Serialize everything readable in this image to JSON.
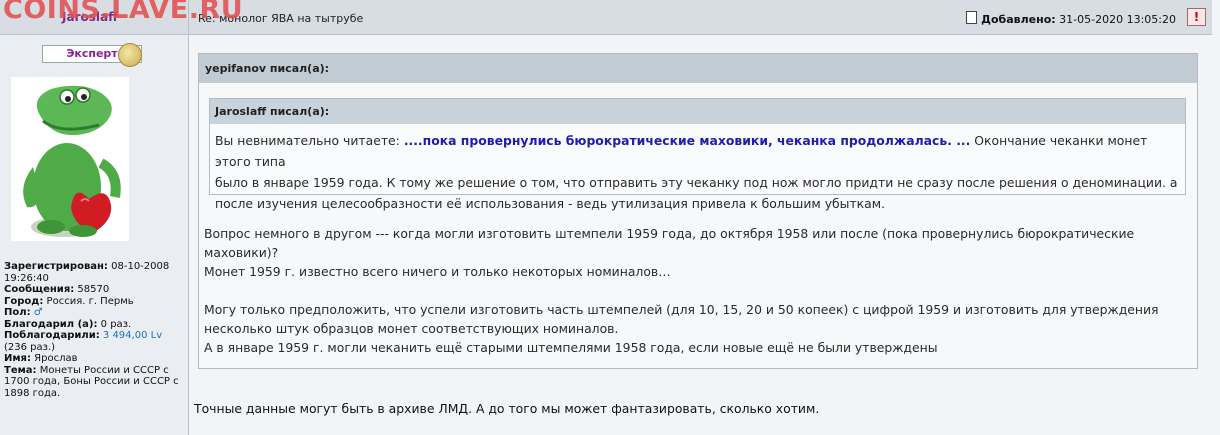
{
  "site": {
    "watermark": "COINS.LAVE.RU"
  },
  "post": {
    "author": "Jaroslaff",
    "subject": "Re: монолог ЯВА на тытрубе",
    "added_label": "Добавлено:",
    "added_date": "31-05-2020 13:05:20",
    "report_label": "!"
  },
  "profile": {
    "rank": "Эксперт",
    "registered_label": "Зарегистрирован:",
    "registered": "08-10-2008 19:26:40",
    "messages_label": "Сообщения:",
    "messages": "58570",
    "city_label": "Город:",
    "city": "Россия. г. Пермь",
    "gender_label": "Пол:",
    "gender_icon": "♂",
    "thanked_label": "Благодарил (а):",
    "thanked": "0 раз.",
    "thanks_label": "Поблагодарили:",
    "thanks_link": "3 494,00 Lv",
    "thanks_count": "(236 раз.)",
    "name_label": "Имя:",
    "name": "Ярослав",
    "topic_label": "Тема:",
    "topic": "Монеты России и СССР с 1700 года, Боны России и СССР с 1898 года."
  },
  "quote_outer": {
    "header": "yepifanov писал(а):",
    "lines": [
      "Вопрос немного в другом --- когда могли изготовить штемпели 1959 года, до октября 1958 или после (пока провернулись бюрократические",
      "маховики)?",
      "Монет 1959 г. известно всего ничего и только некоторых номиналов…",
      "",
      "Могу только предположить, что успели изготовить часть штемпелей (для 10, 15, 20 и 50 копеек) с цифрой 1959 и изготовить для утверждения",
      "несколько штук образцов монет соответствующих номиналов.",
      "А в январе 1959 г. могли чеканить ещё старыми штемпелями 1958 года, если новые ещё не были утверждены"
    ]
  },
  "quote_inner": {
    "header": "Jaroslaff писал(а):",
    "intro": "Вы невнимательно читаете:",
    "bold": "....пока провернулись бюрократические маховики, чеканка продолжалась. ...",
    "rest_first": "Окончание чеканки монет этого типа",
    "line2": "было в январе 1959 года. К тому же решение о том, что отправить эту чеканку под нож могло придти не сразу после решения о деноминации. а",
    "line3": "после изучения целесообразности её использования - ведь утилизация привела к большим убыткам."
  },
  "reply_text": "Точные данные могут быть в архиве ЛМД. А до того мы может фантазировать, сколько хотим."
}
